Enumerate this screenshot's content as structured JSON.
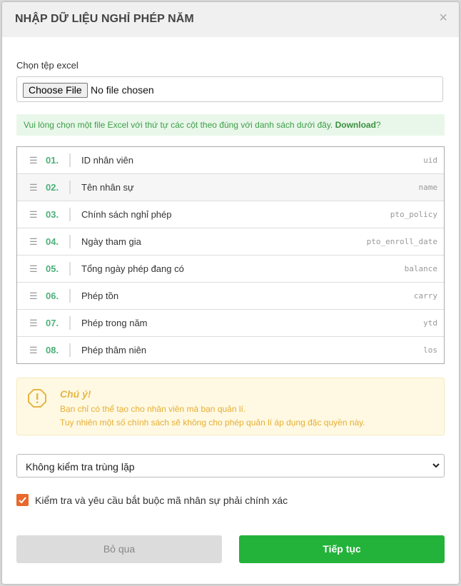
{
  "modal": {
    "title": "NHẬP DỮ LIỆU NGHỈ PHÉP NĂM",
    "close_glyph": "×"
  },
  "file_input": {
    "label": "Chọn tệp excel",
    "button_label": "Choose File",
    "status": "No file chosen"
  },
  "info": {
    "text": "Vui lòng chọn một file Excel với thứ tự các cột theo đúng với danh sách dưới đây. ",
    "download_label": "Download",
    "suffix": "?"
  },
  "columns": [
    {
      "num": "01.",
      "name": "ID nhân viên",
      "key": "uid"
    },
    {
      "num": "02.",
      "name": "Tên nhân sự",
      "key": "name"
    },
    {
      "num": "03.",
      "name": "Chính sách nghỉ phép",
      "key": "pto_policy"
    },
    {
      "num": "04.",
      "name": "Ngày tham gia",
      "key": "pto_enroll_date"
    },
    {
      "num": "05.",
      "name": "Tổng ngày phép đang có",
      "key": "balance"
    },
    {
      "num": "06.",
      "name": "Phép tồn",
      "key": "carry"
    },
    {
      "num": "07.",
      "name": "Phép trong năm",
      "key": "ytd"
    },
    {
      "num": "08.",
      "name": "Phép thâm niên",
      "key": "los"
    }
  ],
  "warning": {
    "title": "Chú ý!",
    "line1": "Bạn chỉ có thể tạo cho nhân viên mà bạn quản lí.",
    "line2": "Tuy nhiên một số chính sách sẽ không cho phép quản lí áp dụng đặc quyền này."
  },
  "duplicate_select": {
    "selected": "Không kiểm tra trùng lặp"
  },
  "strict_check": {
    "label": "Kiểm tra và yêu cầu bắt buộc mã nhân sự phải chính xác",
    "checked": true
  },
  "actions": {
    "skip_label": "Bỏ qua",
    "next_label": "Tiếp tục"
  },
  "colors": {
    "accent_green": "#23b33a",
    "number_green": "#4cb07a",
    "warning": "#e5ae33",
    "checkbox": "#e8692b"
  }
}
